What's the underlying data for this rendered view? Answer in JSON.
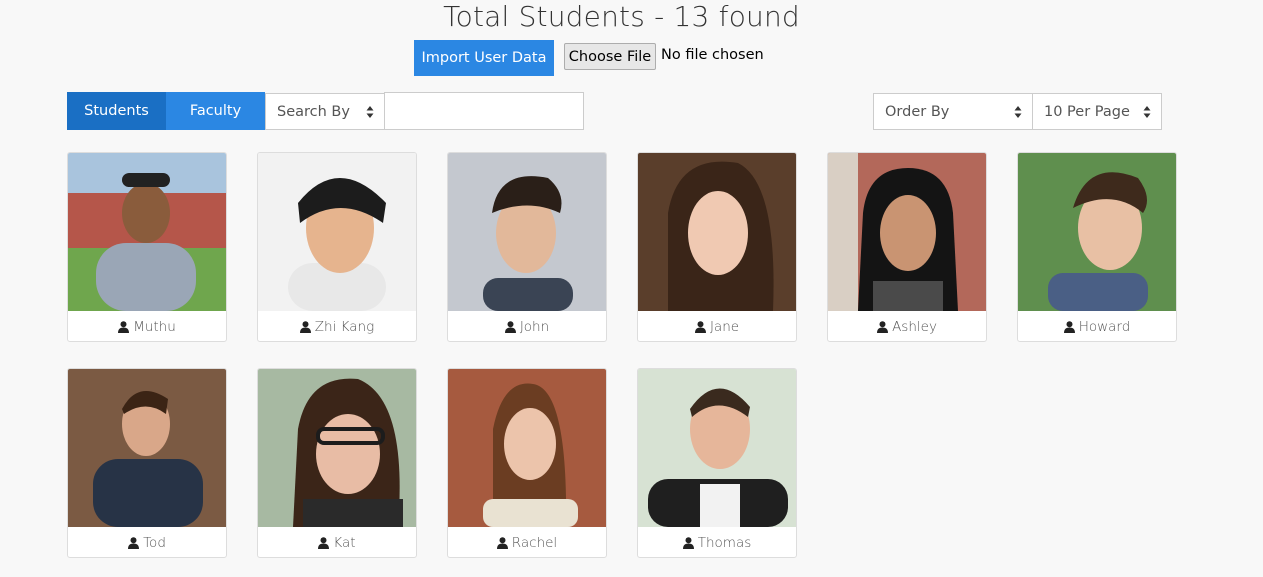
{
  "header": {
    "title": "Total Students - 13 found"
  },
  "import": {
    "button_label": "Import User Data",
    "choose_label": "Choose File",
    "file_status": "No file chosen"
  },
  "tabs": [
    {
      "label": "Students",
      "active": true
    },
    {
      "label": "Faculty",
      "active": false
    }
  ],
  "filters": {
    "search_by": "Search By",
    "search_value": "",
    "order_by": "Order By",
    "per_page": "10 Per Page"
  },
  "colors": {
    "primary": "#2b87e3",
    "primary_active": "#1a6fc4"
  },
  "students": [
    {
      "name": "Muthu",
      "photo": "photo-muthu"
    },
    {
      "name": "Zhi Kang",
      "photo": "photo-zhi-kang"
    },
    {
      "name": "John",
      "photo": "photo-john"
    },
    {
      "name": "Jane",
      "photo": "photo-jane"
    },
    {
      "name": "Ashley",
      "photo": "photo-ashley"
    },
    {
      "name": "Howard",
      "photo": "photo-howard"
    },
    {
      "name": "Tod",
      "photo": "photo-tod"
    },
    {
      "name": "Kat",
      "photo": "photo-kat"
    },
    {
      "name": "Rachel",
      "photo": "photo-rachel"
    },
    {
      "name": "Thomas",
      "photo": "photo-thomas"
    }
  ]
}
